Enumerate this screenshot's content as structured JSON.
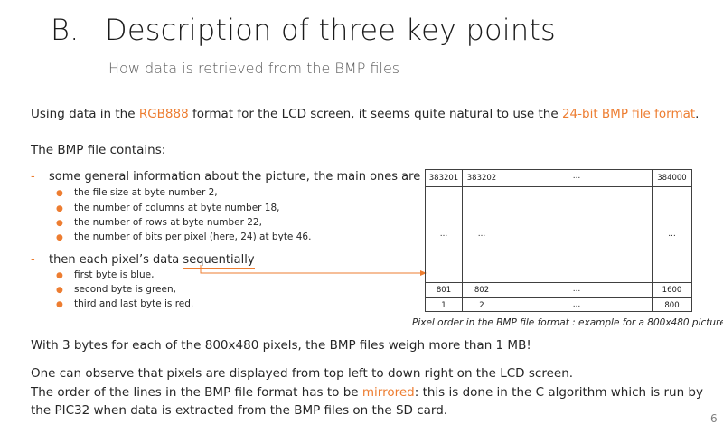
{
  "header": {
    "letter": "B.",
    "title": "Description of three key points",
    "subtitle": "How data is retrieved from the BMP files"
  },
  "intro": {
    "pre": "Using data in the ",
    "hl1": "RGB888",
    "mid": " format for the LCD screen, it seems quite natural to use the ",
    "hl2": "24-bit BMP file format",
    "post": "."
  },
  "contains": "The BMP file contains:",
  "list": {
    "item1": "some general information about the picture, the main ones are",
    "item1_sub": [
      "the file size at byte number 2,",
      "the number of columns at byte number 18,",
      "the number of rows at byte number 22,",
      "the number of bits per pixel (here, 24) at byte 46."
    ],
    "item2_pre": "then each pixel’s data ",
    "item2_ul": "sequentially",
    "item2_sub": [
      "first byte is blue,",
      "second byte is green,",
      "third and last byte is red."
    ]
  },
  "table": {
    "row1": [
      "383201",
      "383202",
      "…",
      "384000"
    ],
    "row_mid": [
      "…",
      "…",
      "…"
    ],
    "row3": [
      "801",
      "802",
      "…",
      "1600"
    ],
    "row4": [
      "1",
      "2",
      "…",
      "800"
    ]
  },
  "caption": "Pixel order in the BMP file format : example for a 800x480 picture.",
  "weight": "With 3 bytes for each of the 800x480 pixels, the BMP files weigh more than 1 MB!",
  "observe": {
    "line1": "One can observe that pixels are displayed from top left to down right on the LCD screen.",
    "line2_pre": "The order of the lines in the BMP file format has to be ",
    "line2_hl": "mirrored",
    "line2_post": ": this is done in the C algorithm which is run by",
    "line3": "the PIC32 when data is extracted from the BMP files on the SD card."
  },
  "page_number": "6",
  "colors": {
    "accent": "#ed7d31",
    "text": "#262626",
    "subtitle": "#595959"
  }
}
